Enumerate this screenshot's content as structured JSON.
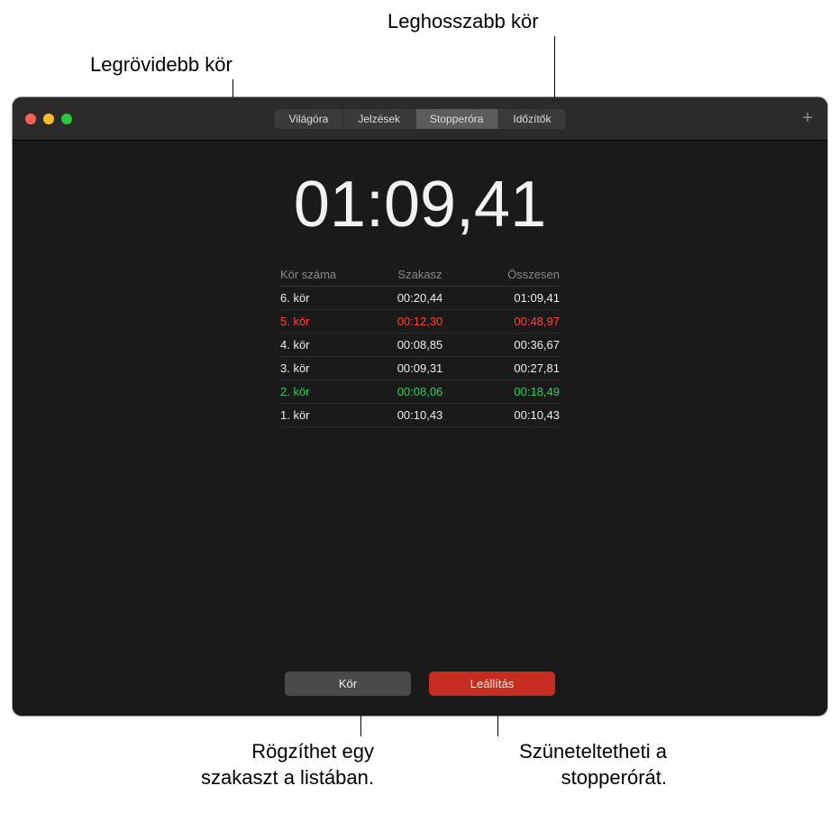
{
  "annotations": {
    "longest_lap": "Leghosszabb kör",
    "shortest_lap": "Legrövidebb kör",
    "record_lap": "Rögzíthet egy\nszakaszt a listában.",
    "pause_stopwatch": "Szüneteltetheti a\nstopperórát."
  },
  "tabs": {
    "items": [
      {
        "label": "Világóra",
        "active": false
      },
      {
        "label": "Jelzések",
        "active": false
      },
      {
        "label": "Stopperóra",
        "active": true
      },
      {
        "label": "Időzítők",
        "active": false
      }
    ]
  },
  "timer_display": "01:09,41",
  "laps_header": {
    "col1": "Kör száma",
    "col2": "Szakasz",
    "col3": "Összesen"
  },
  "laps": [
    {
      "name": "6. kör",
      "split": "00:20,44",
      "total": "01:09,41",
      "flag": ""
    },
    {
      "name": "5. kör",
      "split": "00:12,30",
      "total": "00:48,97",
      "flag": "longest"
    },
    {
      "name": "4. kör",
      "split": "00:08,85",
      "total": "00:36,67",
      "flag": ""
    },
    {
      "name": "3. kör",
      "split": "00:09,31",
      "total": "00:27,81",
      "flag": ""
    },
    {
      "name": "2. kör",
      "split": "00:08,06",
      "total": "00:18,49",
      "flag": "shortest"
    },
    {
      "name": "1. kör",
      "split": "00:10,43",
      "total": "00:10,43",
      "flag": ""
    }
  ],
  "buttons": {
    "lap": "Kör",
    "stop": "Leállítás"
  },
  "plus_icon": "+"
}
